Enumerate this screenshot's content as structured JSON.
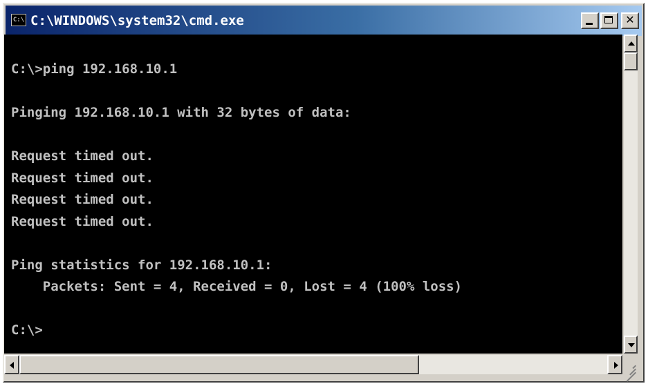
{
  "window": {
    "title": "C:\\WINDOWS\\system32\\cmd.exe",
    "icon_text": "C:\\",
    "minimize_icon": "minimize-icon",
    "maximize_icon": "maximize-icon",
    "close_icon": "close-icon",
    "close_glyph": "✕"
  },
  "console": {
    "lines": [
      "C:\\>ping 192.168.10.1",
      "",
      "Pinging 192.168.10.1 with 32 bytes of data:",
      "",
      "Request timed out.",
      "Request timed out.",
      "Request timed out.",
      "Request timed out.",
      "",
      "Ping statistics for 192.168.10.1:",
      "    Packets: Sent = 4, Received = 0, Lost = 4 (100% loss)",
      "",
      "C:\\>"
    ],
    "text_color": "#c0c0c0",
    "background_color": "#000000"
  },
  "scrollbars": {
    "vertical": {
      "up_icon": "arrow-up-icon",
      "down_icon": "arrow-down-icon"
    },
    "horizontal": {
      "left_icon": "arrow-left-icon",
      "right_icon": "arrow-right-icon"
    }
  }
}
